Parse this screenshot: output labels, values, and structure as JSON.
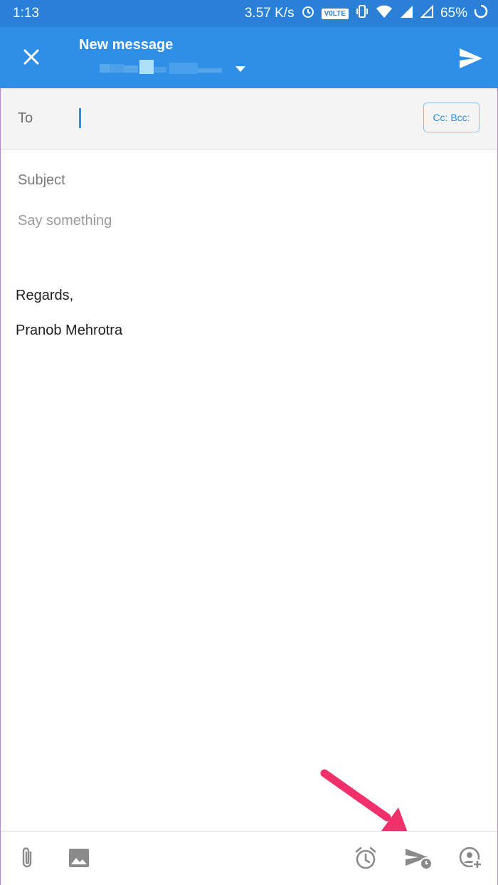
{
  "status_bar": {
    "time": "1:13",
    "network_speed": "3.57 K/s",
    "volte": "V0LTE",
    "battery": "65%"
  },
  "app_bar": {
    "title": "New message"
  },
  "compose": {
    "to_label": "To",
    "cc_bcc_label": "Cc: Bcc:",
    "subject_placeholder": "Subject",
    "body_placeholder": "Say something",
    "signature_line1": "Regards,",
    "signature_line2": "Pranob Mehrotra"
  },
  "toolbar": {
    "icons": [
      "attach-icon",
      "image-icon",
      "alarm-icon",
      "schedule-send-icon",
      "add-contact-icon"
    ]
  },
  "colors": {
    "status_bar": "#2a7fd6",
    "app_bar": "#2f8ee6",
    "highlight_arrow": "#f0306a"
  }
}
